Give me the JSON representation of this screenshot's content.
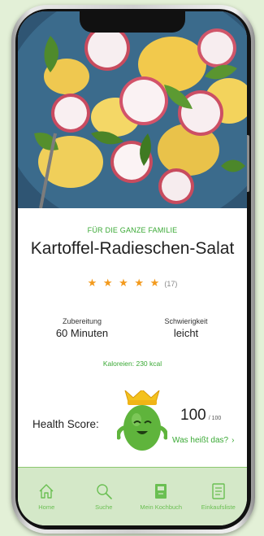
{
  "recipe": {
    "tagline": "FÜR DIE GANZE FAMILIE",
    "title": "Kartoffel-Radieschen-Salat",
    "rating_stars": "★ ★ ★ ★ ★",
    "rating_count": "(17)",
    "rating_value": 5,
    "preparation_label": "Zubereitung",
    "preparation_value": "60 Minuten",
    "difficulty_label": "Schwierigkeit",
    "difficulty_value": "leicht",
    "calories": "Kaloreien: 230 kcal"
  },
  "health": {
    "label": "Health Score:",
    "score": "100",
    "max": "/ 100",
    "link": "Was heißt das?",
    "link_chevron": "›"
  },
  "nav": [
    {
      "label": "Home",
      "icon": "home-icon"
    },
    {
      "label": "Suche",
      "icon": "search-icon"
    },
    {
      "label": "Mein Kochbuch",
      "icon": "cookbook-icon"
    },
    {
      "label": "Einkaufsliste",
      "icon": "shopping-list-icon"
    }
  ],
  "colors": {
    "accent": "#3aa935",
    "star": "#f39a1d",
    "nav_bg": "#d4e8c8",
    "page_bg": "#e3f0d7"
  }
}
